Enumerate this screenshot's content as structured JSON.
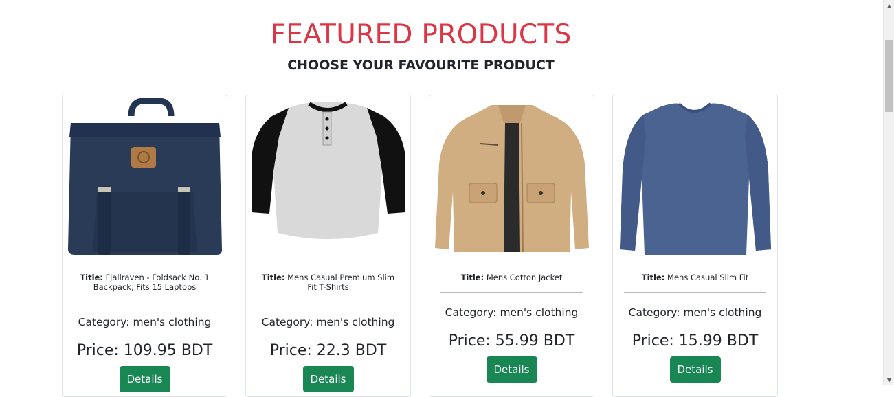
{
  "header": {
    "title": "FEATURED PRODUCTS",
    "subtitle": "CHOOSE YOUR FAVOURITE PRODUCT"
  },
  "products": [
    {
      "title_label": "Title:",
      "title": "Fjallraven - Foldsack No. 1 Backpack, Fits 15 Laptops",
      "category": "Category: men's clothing",
      "price": "Price: 109.95 BDT",
      "details_label": "Details",
      "image": "navy-backpack"
    },
    {
      "title_label": "Title:",
      "title": "Mens Casual Premium Slim Fit T-Shirts",
      "category": "Category: men's clothing",
      "price": "Price: 22.3 BDT",
      "details_label": "Details",
      "image": "raglan-henley-shirt"
    },
    {
      "title_label": "Title:",
      "title": "Mens Cotton Jacket",
      "category": "Category: men's clothing",
      "price": "Price: 55.99 BDT",
      "details_label": "Details",
      "image": "khaki-jacket"
    },
    {
      "title_label": "Title:",
      "title": "Mens Casual Slim Fit",
      "category": "Category: men's clothing",
      "price": "Price: 15.99 BDT",
      "details_label": "Details",
      "image": "blue-long-sleeve-tee"
    }
  ],
  "colors": {
    "heading": "#dc3545",
    "button": "#198754"
  }
}
